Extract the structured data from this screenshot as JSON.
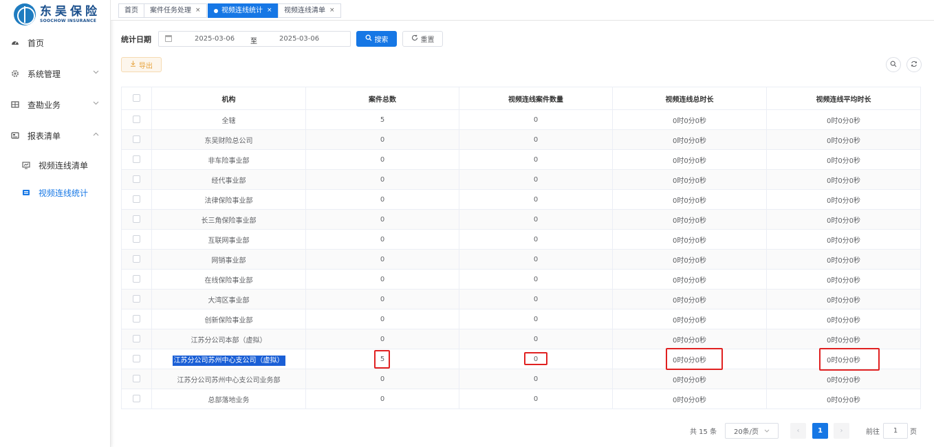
{
  "brand": {
    "name_cn": "东吴保险",
    "name_en": "SOOCHOW INSURANCE"
  },
  "sidebar": {
    "items": [
      {
        "label": "首页",
        "icon": "dashboard-icon"
      },
      {
        "label": "系统管理",
        "icon": "gear-icon",
        "chevron": "chevron-down"
      },
      {
        "label": "查勘业务",
        "icon": "grid-icon",
        "chevron": "chevron-down"
      },
      {
        "label": "报表清单",
        "icon": "report-icon",
        "chevron": "chevron-up"
      },
      {
        "label": "视频连线清单",
        "icon": "monitor-icon"
      },
      {
        "label": "视频连线统计",
        "icon": "chart-icon",
        "active": true
      }
    ]
  },
  "tabs": [
    {
      "label": "首页"
    },
    {
      "label": "案件任务处理"
    },
    {
      "label": "视频连线统计",
      "active": true
    },
    {
      "label": "视频连线清单"
    }
  ],
  "search": {
    "date_label": "统计日期",
    "start_date": "2025-03-06",
    "separator": "至",
    "end_date": "2025-03-06",
    "search_label": "搜索",
    "reset_label": "重置",
    "export_label": "导出"
  },
  "table": {
    "columns": [
      "机构",
      "案件总数",
      "视频连线案件数量",
      "视频连线总时长",
      "视频连线平均时长"
    ],
    "rows": [
      [
        "全辖",
        "5",
        "0",
        "0时0分0秒",
        "0时0分0秒"
      ],
      [
        "东吴财险总公司",
        "0",
        "0",
        "0时0分0秒",
        "0时0分0秒"
      ],
      [
        "非车险事业部",
        "0",
        "0",
        "0时0分0秒",
        "0时0分0秒"
      ],
      [
        "经代事业部",
        "0",
        "0",
        "0时0分0秒",
        "0时0分0秒"
      ],
      [
        "法律保险事业部",
        "0",
        "0",
        "0时0分0秒",
        "0时0分0秒"
      ],
      [
        "长三角保险事业部",
        "0",
        "0",
        "0时0分0秒",
        "0时0分0秒"
      ],
      [
        "互联网事业部",
        "0",
        "0",
        "0时0分0秒",
        "0时0分0秒"
      ],
      [
        "网销事业部",
        "0",
        "0",
        "0时0分0秒",
        "0时0分0秒"
      ],
      [
        "在线保险事业部",
        "0",
        "0",
        "0时0分0秒",
        "0时0分0秒"
      ],
      [
        "大湾区事业部",
        "0",
        "0",
        "0时0分0秒",
        "0时0分0秒"
      ],
      [
        "创新保险事业部",
        "0",
        "0",
        "0时0分0秒",
        "0时0分0秒"
      ],
      [
        "江苏分公司本部（虚拟）",
        "0",
        "0",
        "0时0分0秒",
        "0时0分0秒"
      ],
      [
        "江苏分公司苏州中心支公司（虚拟）",
        "5",
        "0",
        "0时0分0秒",
        "0时0分0秒"
      ],
      [
        "江苏分公司苏州中心支公司业务部",
        "0",
        "0",
        "0时0分0秒",
        "0时0分0秒"
      ],
      [
        "总部落地业务",
        "0",
        "0",
        "0时0分0秒",
        "0时0分0秒"
      ]
    ]
  },
  "pagination": {
    "total_text": "共 15 条",
    "page_size": "20条/页",
    "prev": "‹",
    "current_page": "1",
    "next": "›",
    "goto_label": "前往",
    "goto_value": "1",
    "page_suffix": "页"
  },
  "colors": {
    "primary": "#1677e5",
    "highlight": "#1a5fd6",
    "annotation_red": "#e02020",
    "export_warn": "#e6a23c"
  }
}
